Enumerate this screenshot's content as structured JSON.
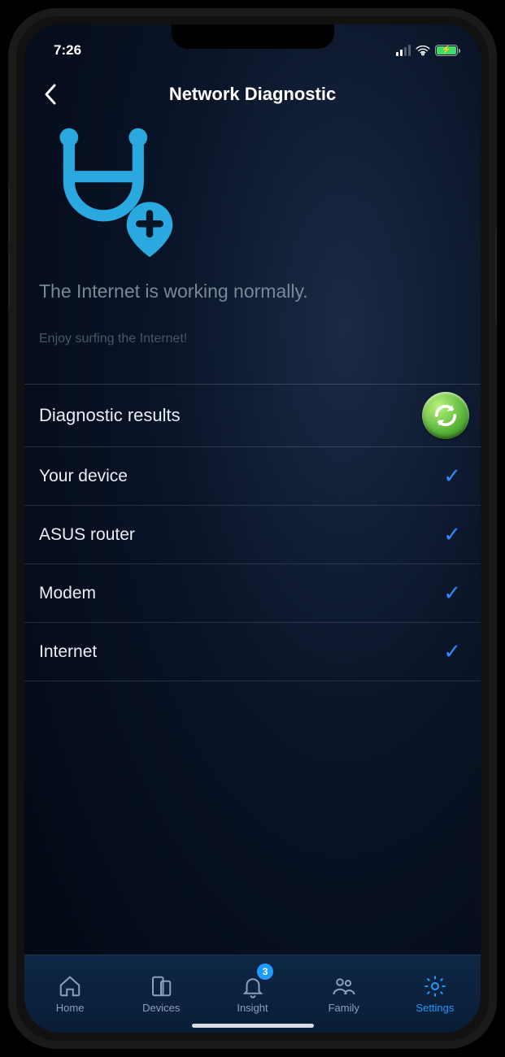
{
  "statusbar": {
    "time": "7:26"
  },
  "header": {
    "title": "Network Diagnostic"
  },
  "hero": {
    "status": "The Internet is working normally.",
    "subtitle": "Enjoy surfing the Internet!"
  },
  "results": {
    "heading": "Diagnostic results",
    "items": [
      {
        "label": "Your device",
        "ok": true
      },
      {
        "label": "ASUS router",
        "ok": true
      },
      {
        "label": "Modem",
        "ok": true
      },
      {
        "label": "Internet",
        "ok": true
      }
    ]
  },
  "tabs": {
    "items": [
      {
        "label": "Home"
      },
      {
        "label": "Devices"
      },
      {
        "label": "Insight",
        "badge": "3"
      },
      {
        "label": "Family"
      },
      {
        "label": "Settings",
        "active": true
      }
    ]
  },
  "colors": {
    "accent": "#1f9bff",
    "check": "#2a8cff",
    "refresh": "#57b238"
  }
}
